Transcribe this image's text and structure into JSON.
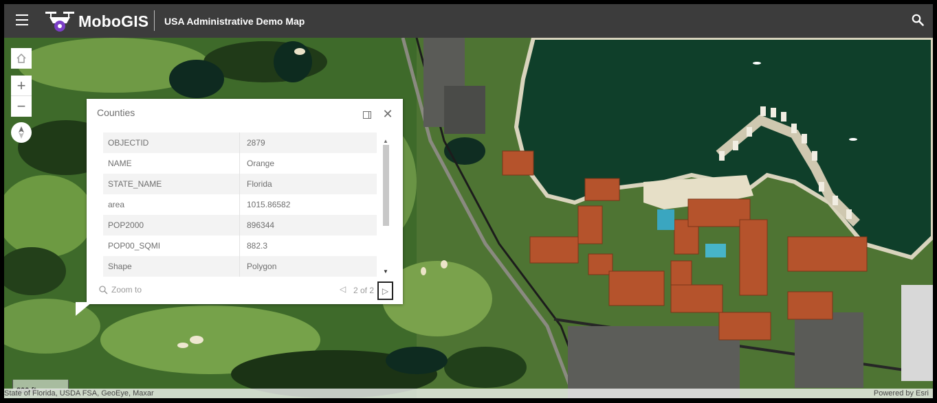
{
  "header": {
    "brand": "MoboGIS",
    "app_title": "USA Administrative Demo Map"
  },
  "popup": {
    "title": "Counties",
    "attributes": [
      {
        "key": "OBJECTID",
        "value": "2879"
      },
      {
        "key": "NAME",
        "value": "Orange"
      },
      {
        "key": "STATE_NAME",
        "value": "Florida"
      },
      {
        "key": "area",
        "value": "1015.86582"
      },
      {
        "key": "POP2000",
        "value": "896344"
      },
      {
        "key": "POP00_SQMI",
        "value": "882.3"
      },
      {
        "key": "Shape",
        "value": "Polygon"
      }
    ],
    "zoom_label": "Zoom to",
    "pager": "2 of 2"
  },
  "map": {
    "scale_label": "800 ft",
    "attribution": "State of Florida, USDA FSA, GeoEye, Maxar",
    "powered_by": "Powered by Esri"
  },
  "colors": {
    "header_bg": "#3c3c3c",
    "water": "#0f3f2a",
    "roof": "#b5532c",
    "grass": "#5f8a3a"
  }
}
